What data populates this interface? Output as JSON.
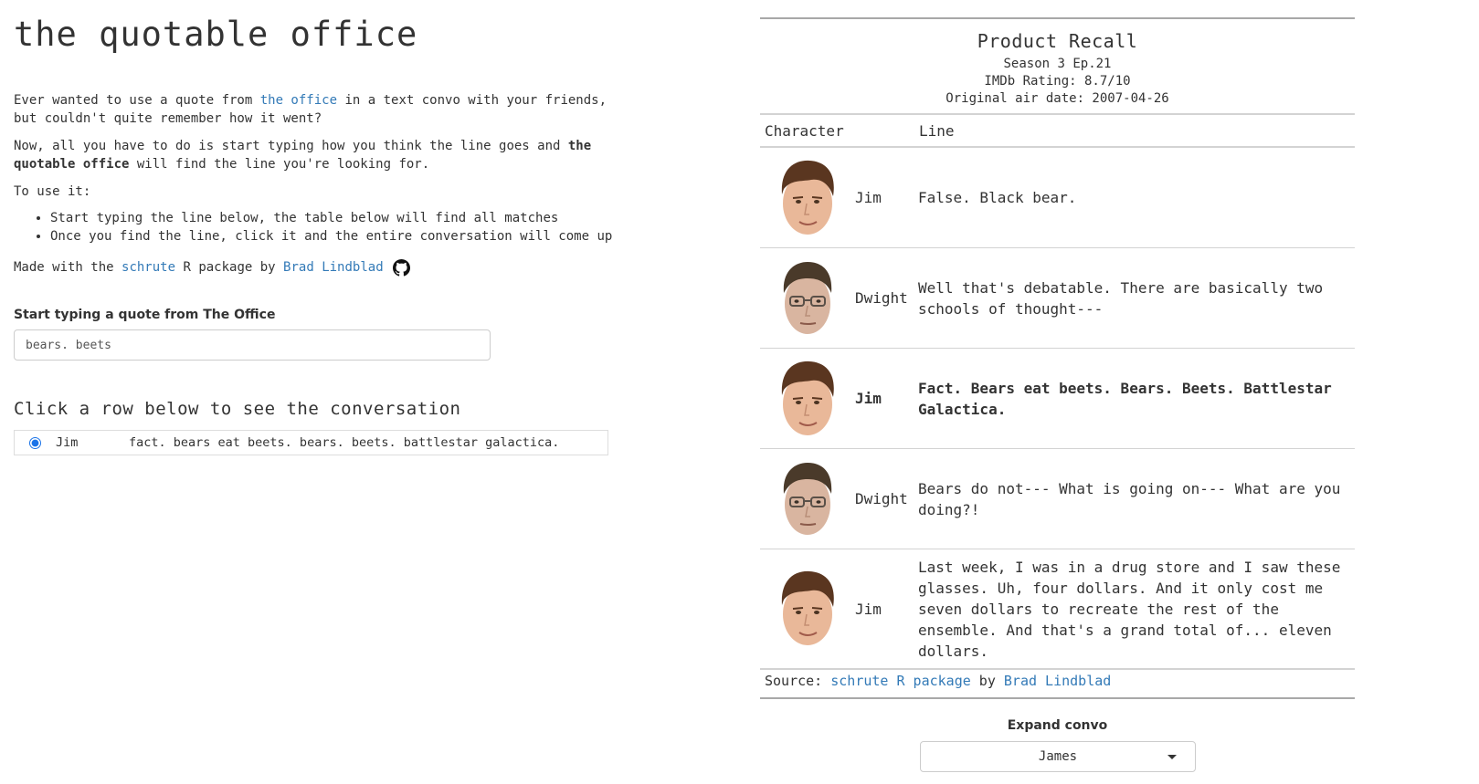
{
  "app": {
    "title": "the quotable office",
    "intro": {
      "p1_a": "Ever wanted to use a quote from ",
      "p1_link": "the office",
      "p1_b": " in a text convo with your friends, but couldn't quite remember how it went?",
      "p2_a": "Now, all you have to do is start typing how you think the line goes and ",
      "p2_bold": "the quotable office",
      "p2_b": " will find the line you're looking for.",
      "p3": "To use it:",
      "bullets": [
        "Start typing the line below, the table below will find all matches",
        "Once you find the line, click it and the entire conversation will come up"
      ],
      "p4_a": "Made with the ",
      "p4_link1": "schrute",
      "p4_b": " R package by ",
      "p4_link2": "Brad Lindblad",
      "github_icon": "github-icon"
    }
  },
  "search": {
    "label": "Start typing a quote from The Office",
    "value": "bears. beets"
  },
  "results": {
    "heading": "Click a row below to see the conversation",
    "rows": [
      {
        "character": "Jim",
        "line": "fact. bears eat beets. bears. beets. battlestar galactica.",
        "selected": true
      }
    ]
  },
  "episode": {
    "title": "Product Recall",
    "season_ep": "Season 3 Ep.21",
    "rating": "IMDb Rating: 8.7/10",
    "air_date": "Original air date: 2007-04-26",
    "col_character": "Character",
    "col_line": "Line",
    "rows": [
      {
        "character": "Jim",
        "face": "jim-face",
        "line": "False. Black bear."
      },
      {
        "character": "Dwight",
        "face": "dwight-face",
        "line": "Well that's debatable. There are basically two schools of thought---"
      },
      {
        "character": "Jim",
        "face": "jim-face",
        "line": "Fact. Bears eat beets. Bears. Beets. Battlestar Galactica.",
        "highlight": true
      },
      {
        "character": "Dwight",
        "face": "dwight-face",
        "line": "Bears do not--- What is going on--- What are you doing?!"
      },
      {
        "character": "Jim",
        "face": "jim-face",
        "line": "Last week, I was in a drug store and I saw these glasses. Uh, four dollars. And it only cost me seven dollars to recreate the rest of the ensemble. And that's a grand total of... eleven dollars."
      }
    ],
    "source_a": "Source: ",
    "source_link1": "schrute R package",
    "source_b": " by ",
    "source_link2": "Brad Lindblad"
  },
  "expand": {
    "label": "Expand convo",
    "selected": "James"
  },
  "colors": {
    "link": "#337ab7",
    "radio": "#1a73e8",
    "rule_dark": "#a8a8a8",
    "rule_light": "#d3d3d3"
  }
}
